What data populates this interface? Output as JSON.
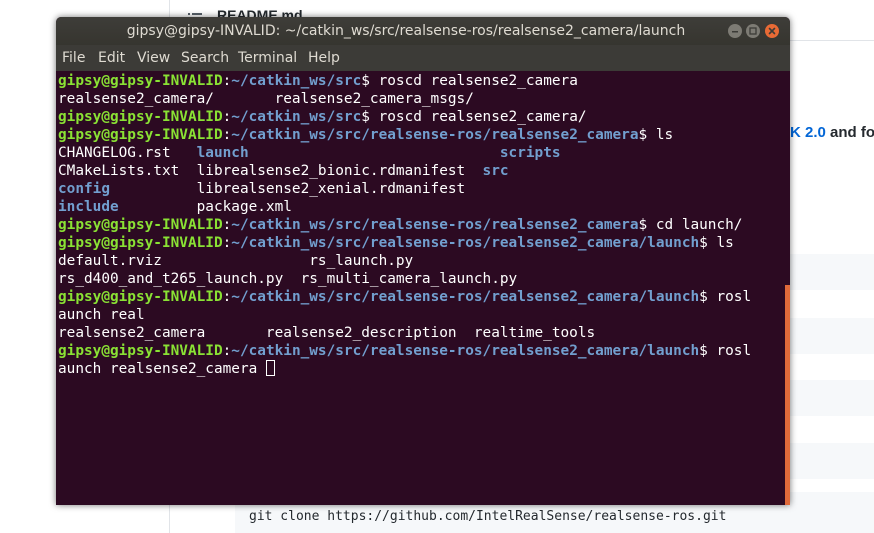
{
  "background_page": {
    "readme_title": "README.md",
    "sdk_link_text": "K 2.0",
    "sdk_trailing_text": " and fo",
    "git_clone_command": "git clone https://github.com/IntelRealSense/realsense-ros.git"
  },
  "window": {
    "title": "gipsy@gipsy-INVALID: ~/catkin_ws/src/realsense-ros/realsense2_camera/launch"
  },
  "menu": {
    "file": "File",
    "edit": "Edit",
    "view": "View",
    "search": "Search",
    "terminal": "Terminal",
    "help": "Help"
  },
  "terminal": {
    "prompt_user": "gipsy@gipsy-INVALID",
    "line1": {
      "path": "~/catkin_ws/src",
      "cmd": "$ roscd realsense2_camera"
    },
    "line2": {
      "text": "realsense2_camera/       realsense2_camera_msgs/"
    },
    "line3": {
      "path": "~/catkin_ws/src",
      "cmd": "$ roscd realsense2_camera/"
    },
    "line4": {
      "path": "~/catkin_ws/src/realsense-ros/realsense2_camera",
      "cmd": "$ ls"
    },
    "ls1": {
      "a": "CHANGELOG.rst",
      "a_pad": "   ",
      "b": "launch",
      "b_pad": "                             ",
      "c": "scripts"
    },
    "ls2": {
      "a": "CMakeLists.txt",
      "a_pad": "  ",
      "b": "librealsense2_bionic.rdmanifest",
      "b_pad": "  ",
      "c": "src"
    },
    "ls3": {
      "a": "config",
      "a_pad": "          ",
      "b": "librealsense2_xenial.rdmanifest"
    },
    "ls4": {
      "a": "include",
      "a_pad": "         ",
      "b": "package.xml"
    },
    "line9": {
      "path": "~/catkin_ws/src/realsense-ros/realsense2_camera",
      "cmd": "$ cd launch/"
    },
    "line10": {
      "path": "~/catkin_ws/src/realsense-ros/realsense2_camera/launch",
      "cmd": "$ ls"
    },
    "ls5": {
      "text": "default.rviz                 rs_launch.py"
    },
    "ls6": {
      "text": "rs_d400_and_t265_launch.py  rs_multi_camera_launch.py"
    },
    "line13": {
      "path": "~/catkin_ws/src/realsense-ros/realsense2_camera/launch",
      "cmd": "$ rosl"
    },
    "line14": {
      "text": "aunch real"
    },
    "line15": {
      "text": "realsense2_camera       realsense2_description  realtime_tools"
    },
    "line16": {
      "path": "~/catkin_ws/src/realsense-ros/realsense2_camera/launch",
      "cmd": "$ rosl"
    },
    "line17": {
      "text": "aunch realsense2_camera "
    }
  },
  "colors": {
    "terminal_bg": "#2c0a22",
    "prompt_user": "#8ae234",
    "prompt_path": "#729fcf",
    "scrollbar": "#e06a3a",
    "close_button": "#e86a35"
  }
}
